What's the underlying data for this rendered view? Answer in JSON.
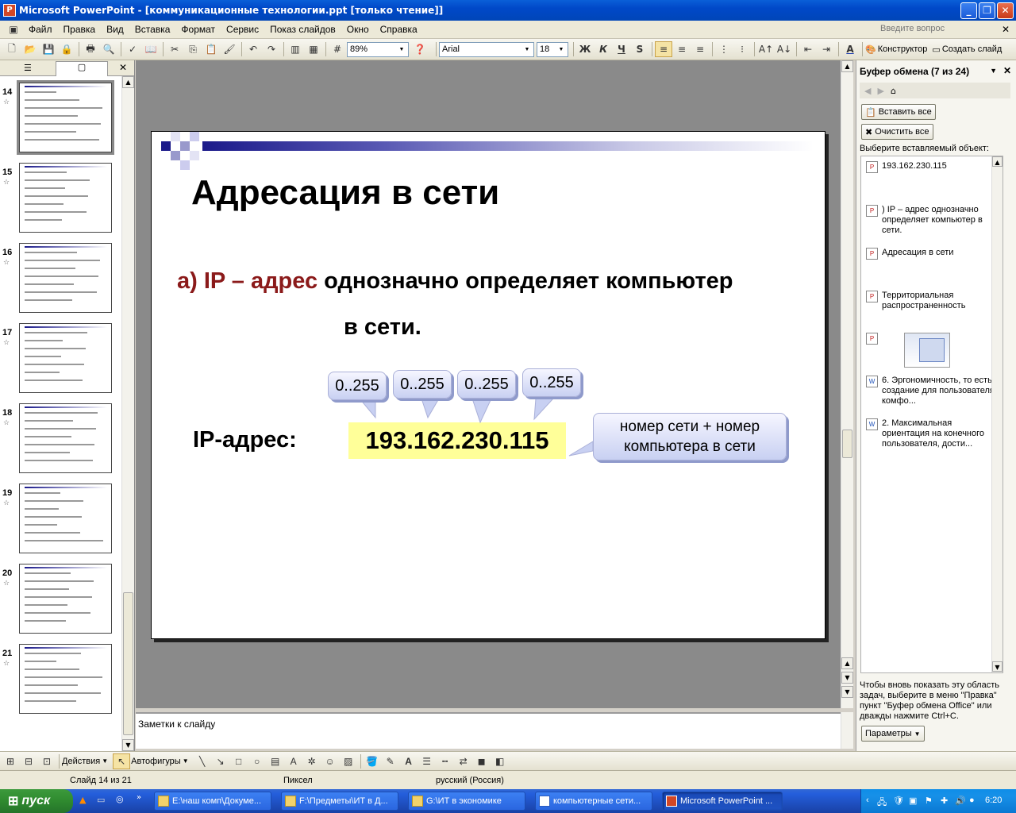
{
  "window": {
    "title": "Microsoft PowerPoint - [коммуникационные технологии.ppt [только чтение]]"
  },
  "menu": {
    "items": [
      "Файл",
      "Правка",
      "Вид",
      "Вставка",
      "Формат",
      "Сервис",
      "Показ слайдов",
      "Окно",
      "Справка"
    ],
    "help_placeholder": "Введите вопрос"
  },
  "toolbar": {
    "zoom": "89%",
    "font": "Arial",
    "font_size": "18",
    "bold": "Ж",
    "italic": "К",
    "underline": "Ч",
    "shadow": "S",
    "designer": "Конструктор",
    "new_slide": "Создать слайд"
  },
  "slides_panel": {
    "slides": [
      {
        "num": "14",
        "selected": true
      },
      {
        "num": "15"
      },
      {
        "num": "16"
      },
      {
        "num": "17"
      },
      {
        "num": "18"
      },
      {
        "num": "19"
      },
      {
        "num": "20"
      },
      {
        "num": "21"
      }
    ]
  },
  "slide": {
    "title": "Адресация в сети",
    "line_prefix": "а) IP – адрес",
    "line_rest": "однозначно определяет компьютер",
    "line2": "в сети.",
    "ip_label": "IP-адрес:",
    "ip_value": "193.162.230.115",
    "octets": [
      "0..255",
      "0..255",
      "0..255",
      "0..255"
    ],
    "callout": "номер сети + номер компьютера в сети",
    "accent_color": "#8b1a1a",
    "highlight_color": "#ffff99"
  },
  "notes": {
    "placeholder": "Заметки к слайду"
  },
  "taskpane": {
    "title": "Буфер обмена (7 из 24)",
    "paste_all": "Вставить все",
    "clear_all": "Очистить все",
    "select_label": "Выберите вставляемый объект:",
    "items": [
      {
        "text": "193.162.230.115",
        "icon": "ppt-icon"
      },
      {
        "text": ") IP – адрес однозначно определяет компьютер в сети.",
        "icon": "ppt-icon"
      },
      {
        "text": "Адресация в сети",
        "icon": "ppt-icon"
      },
      {
        "text": "Территориальная распространенность",
        "icon": "ppt-icon"
      },
      {
        "text": "",
        "icon": "ppt-icon"
      },
      {
        "text": "6. Эргономичность, то есть создание для пользователя комфо...",
        "icon": "word-icon"
      },
      {
        "text": "2. Максимальная ориентация на конечного пользователя, дости...",
        "icon": "word-icon"
      }
    ],
    "hint": "Чтобы вновь показать эту область задач, выберите в меню \"Правка\" пункт \"Буфер обмена Office\" или дважды нажмите Ctrl+C.",
    "options": "Параметры"
  },
  "drawbar": {
    "actions": "Действия",
    "autoshapes": "Автофигуры"
  },
  "status": {
    "slide": "Слайд 14 из 21",
    "design": "Пиксел",
    "language": "русский (Россия)"
  },
  "taskbar": {
    "start": "пуск",
    "tasks": [
      "E:\\наш комп\\Докуме...",
      "F:\\Предметы\\ИТ в Д...",
      "G:\\ИТ в экономике",
      "компьютерные сети...",
      "Microsoft PowerPoint ..."
    ],
    "clock": "6:20"
  }
}
